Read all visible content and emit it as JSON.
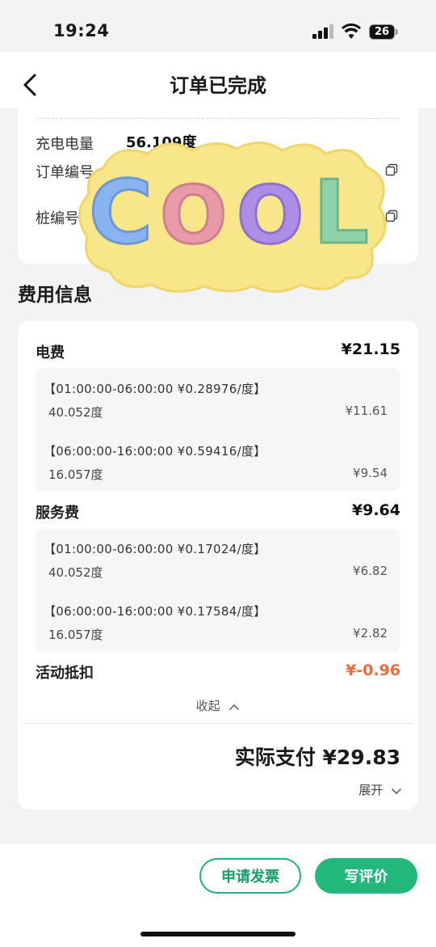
{
  "status_bar": {
    "time": "19:24",
    "battery": "26"
  },
  "nav": {
    "title": "订单已完成"
  },
  "order": {
    "energy_label": "充电电量",
    "energy_value": "56.109度",
    "order_no_label": "订单编号",
    "pile_no_label": "桩编号"
  },
  "sticker": {
    "text": "COOL",
    "letter_colors": [
      "#8ab4f0",
      "#e89aa8",
      "#ad8ee6",
      "#8fd1a8"
    ],
    "bg_color": "#f8e68a"
  },
  "fees": {
    "section_title": "费用信息",
    "electricity": {
      "label": "电费",
      "total": "¥21.15",
      "tiers": [
        {
          "range": "【01:00:00-06:00:00  ¥0.28976/度】",
          "kwh": "40.052度",
          "amount": "¥11.61"
        },
        {
          "range": "【06:00:00-16:00:00  ¥0.59416/度】",
          "kwh": "16.057度",
          "amount": "¥9.54"
        }
      ]
    },
    "service": {
      "label": "服务费",
      "total": "¥9.64",
      "tiers": [
        {
          "range": "【01:00:00-06:00:00  ¥0.17024/度】",
          "kwh": "40.052度",
          "amount": "¥6.82"
        },
        {
          "range": "【06:00:00-16:00:00  ¥0.17584/度】",
          "kwh": "16.057度",
          "amount": "¥2.82"
        }
      ]
    },
    "discount": {
      "label": "活动抵扣",
      "value": "¥-0.96"
    },
    "collapse_label": "收起",
    "total_label": "实际支付 ¥29.83",
    "expand_label": "展开"
  },
  "actions": {
    "invoice": "申请发票",
    "review": "写评价"
  },
  "colors": {
    "accent": "#22b87c",
    "discount": "#ef6b3a"
  }
}
